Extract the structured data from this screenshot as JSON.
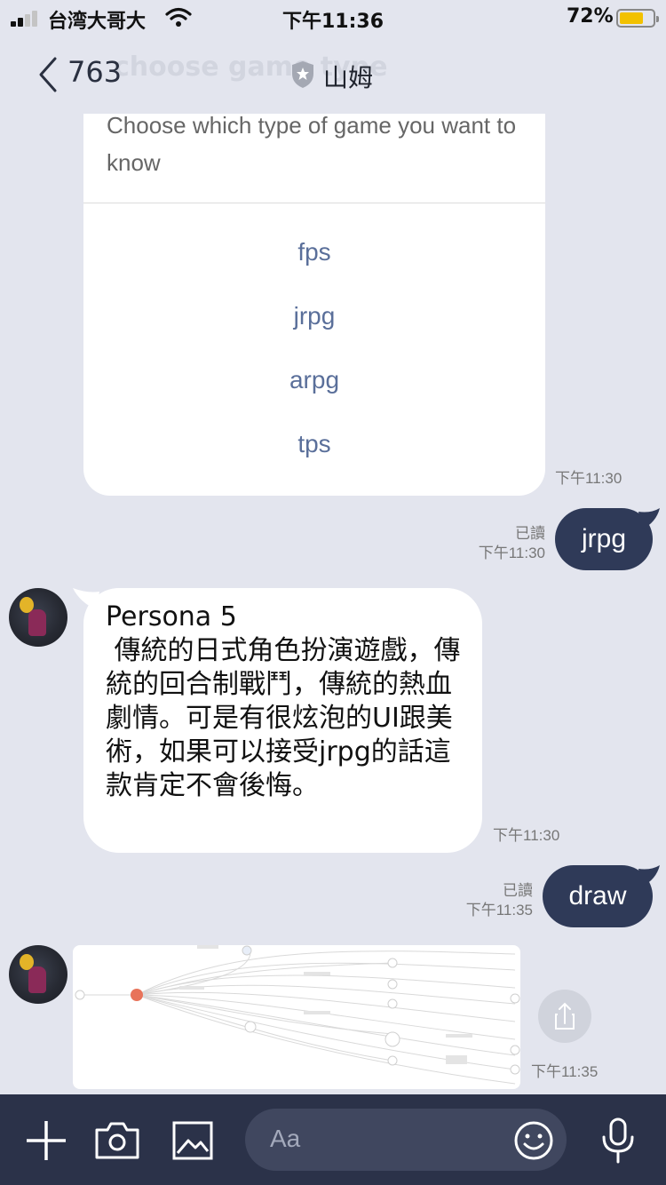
{
  "status_bar": {
    "carrier": "台湾大哥大",
    "time": "下午11:36",
    "battery_percent": "72%",
    "battery_level": 0.72,
    "signal_bars": 2
  },
  "header": {
    "unread_count": "763",
    "ghost_text": "choose game type",
    "title": "山姆"
  },
  "card": {
    "description": "Choose which type of game you want to know",
    "options": [
      "fps",
      "jrpg",
      "arpg",
      "tps"
    ],
    "time": "下午11:30"
  },
  "messages": [
    {
      "text": "jrpg",
      "read": "已讀",
      "time": "下午11:30"
    },
    {
      "text": "Persona 5\n 傳統的日式角色扮演遊戲，傳統的回合制戰鬥，傳統的熱血劇情。可是有很炫泡的UI跟美術，如果可以接受jrpg的話這款肯定不會後悔。",
      "time": "下午11:30"
    },
    {
      "text": "draw",
      "read": "已讀",
      "time": "下午11:35"
    },
    {
      "time": "下午11:35"
    }
  ],
  "input": {
    "placeholder": "Aa"
  },
  "colors": {
    "background": "#e3e5ee",
    "outgoing_bubble": "#2f3a58",
    "option_link": "#5a6f9a",
    "bottom_bar": "#2b3249"
  },
  "icons": [
    "back-icon",
    "shield-icon",
    "wifi-icon",
    "share-icon",
    "plus-icon",
    "camera-icon",
    "image-icon",
    "emoji-icon",
    "microphone-icon"
  ]
}
